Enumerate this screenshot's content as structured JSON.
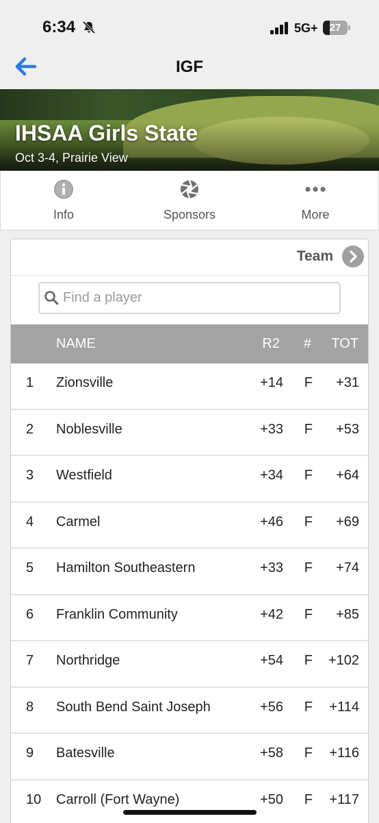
{
  "status_bar": {
    "time": "6:34",
    "network": "5G+",
    "battery": "27",
    "battery_level": 0.27,
    "icons": [
      "bell-slash-icon",
      "signal-icon"
    ]
  },
  "nav": {
    "title": "IGF",
    "back_icon": "back-arrow-icon",
    "accent_color": "#2f7be0"
  },
  "banner": {
    "title": "IHSAA Girls State",
    "subtitle": "Oct 3-4, Prairie View"
  },
  "tabs": [
    {
      "label": "Info",
      "icon": "info-icon"
    },
    {
      "label": "Sponsors",
      "icon": "aperture-icon"
    },
    {
      "label": "More",
      "icon": "more-icon"
    }
  ],
  "leaderboard": {
    "view_toggle": "Team",
    "search_placeholder": "Find a player",
    "columns": {
      "pos": "",
      "name": "NAME",
      "r2": "R2",
      "hole": "#",
      "tot": "TOT"
    },
    "rows": [
      {
        "pos": "1",
        "name": "Zionsville",
        "r2": "+14",
        "hole": "F",
        "tot": "+31"
      },
      {
        "pos": "2",
        "name": "Noblesville",
        "r2": "+33",
        "hole": "F",
        "tot": "+53"
      },
      {
        "pos": "3",
        "name": "Westfield",
        "r2": "+34",
        "hole": "F",
        "tot": "+64"
      },
      {
        "pos": "4",
        "name": "Carmel",
        "r2": "+46",
        "hole": "F",
        "tot": "+69"
      },
      {
        "pos": "5",
        "name": "Hamilton Southeastern",
        "r2": "+33",
        "hole": "F",
        "tot": "+74"
      },
      {
        "pos": "6",
        "name": "Franklin Community",
        "r2": "+42",
        "hole": "F",
        "tot": "+85"
      },
      {
        "pos": "7",
        "name": "Northridge",
        "r2": "+54",
        "hole": "F",
        "tot": "+102"
      },
      {
        "pos": "8",
        "name": "South Bend Saint Joseph",
        "r2": "+56",
        "hole": "F",
        "tot": "+114"
      },
      {
        "pos": "9",
        "name": "Batesville",
        "r2": "+58",
        "hole": "F",
        "tot": "+116"
      },
      {
        "pos": "10",
        "name": "Carroll (Fort Wayne)",
        "r2": "+50",
        "hole": "F",
        "tot": "+117"
      }
    ]
  }
}
